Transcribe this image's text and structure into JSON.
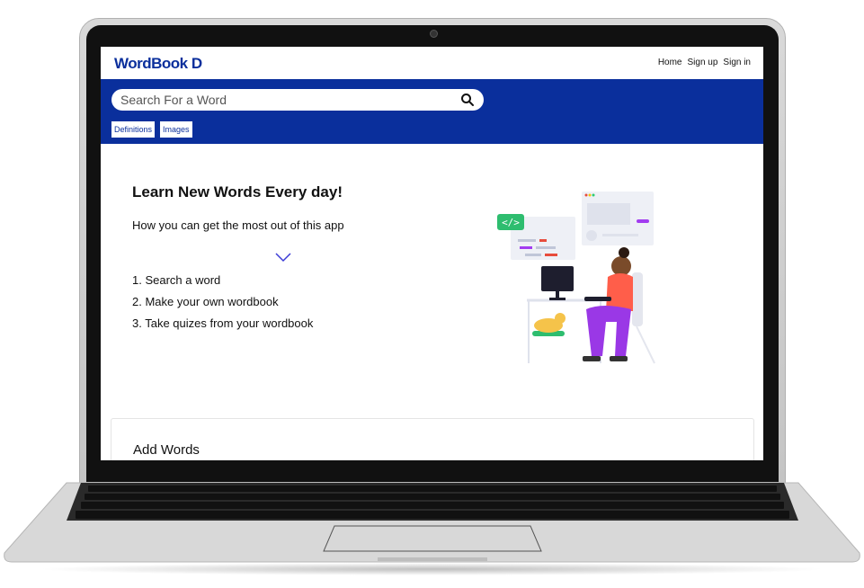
{
  "app": {
    "logo": "WordBook D",
    "nav": {
      "home": "Home",
      "signup": "Sign up",
      "signin": "Sign in"
    }
  },
  "search": {
    "placeholder": "Search For a Word"
  },
  "tabs": [
    {
      "label": "Definitions"
    },
    {
      "label": "Images"
    }
  ],
  "hero": {
    "title": "Learn New Words Every day!",
    "subtitle": "How you can get the most out of this app",
    "steps": [
      "1. Search a word",
      "2. Make your own wordbook",
      "3. Take quizes from your wordbook"
    ]
  },
  "section": {
    "title": "Add Words"
  },
  "colors": {
    "brand": "#0a2f9c"
  },
  "icons": {
    "search": "search-icon",
    "chevron": "chevron-down-icon"
  }
}
